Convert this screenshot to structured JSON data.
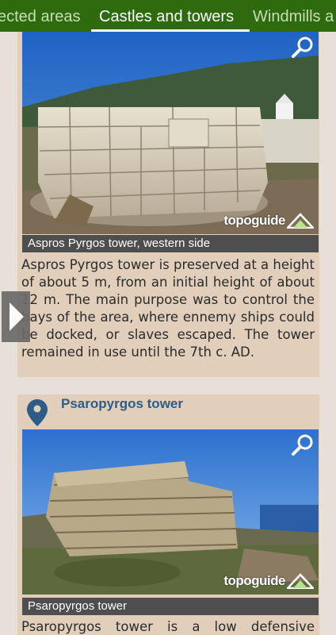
{
  "tabs": [
    {
      "label": "ected areas",
      "active": false
    },
    {
      "label": "Castles and towers",
      "active": true
    },
    {
      "label": "Windmills a",
      "active": false
    }
  ],
  "colors": {
    "tab_bar": "#2e6b0f",
    "card_bg": "#e1cfbc",
    "caption_bg": "#4e4e4e",
    "title_text": "#2d5d86"
  },
  "cards": [
    {
      "image_icon": "landscape-photo",
      "zoom_icon": "magnifier-icon",
      "watermark": "topoguide",
      "caption": "Aspros Pyrgos tower, western side",
      "description": "Aspros Pyrgos tower is preserved at a height of about 5 m, from an initial height of about 12 m. The main purpose was to control the bays of the area, where ennemy ships could be docked, or slaves escaped. The tower remained in use until the 7th c. AD."
    },
    {
      "pin_icon": "map-pin-icon",
      "title": "Psaropyrgos tower",
      "zoom_icon": "magnifier-icon",
      "watermark": "topoguide",
      "caption": "Psaropyrgos tower",
      "description": "Psaropyrgos tower is a low defensive"
    }
  ],
  "navigation": {
    "prev_icon": "triangle-right-icon"
  }
}
